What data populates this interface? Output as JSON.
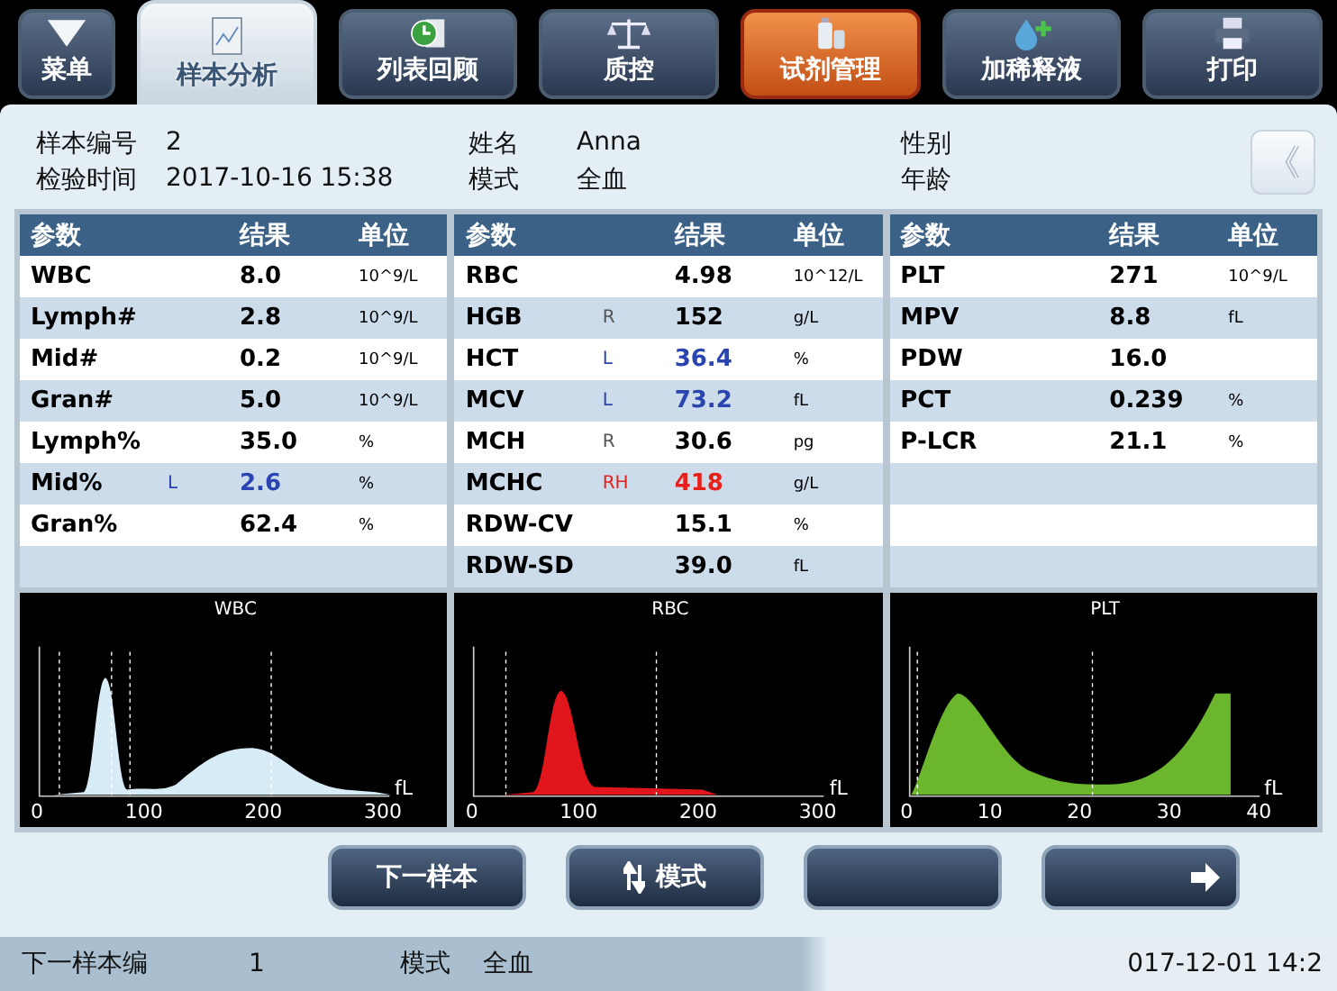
{
  "tabs": [
    {
      "label": "菜单",
      "kind": "menu",
      "selected": false,
      "alert": false
    },
    {
      "label": "样本分析",
      "kind": "chart",
      "selected": true,
      "alert": false
    },
    {
      "label": "列表回顾",
      "kind": "review",
      "selected": false,
      "alert": false
    },
    {
      "label": "质控",
      "kind": "scale",
      "selected": false,
      "alert": false
    },
    {
      "label": "试剂管理",
      "kind": "bottles",
      "selected": false,
      "alert": true
    },
    {
      "label": "加稀释液",
      "kind": "drop",
      "selected": false,
      "alert": false
    },
    {
      "label": "打印",
      "kind": "printer",
      "selected": false,
      "alert": false
    }
  ],
  "info": [
    {
      "label": "样本编号",
      "value": "2"
    },
    {
      "label": "姓名",
      "value": "Anna"
    },
    {
      "label": "性别"
    },
    {
      "label": "检验时间",
      "value": "2017-10-16 15:38"
    },
    {
      "label": "模式",
      "value": "全血"
    },
    {
      "label": "年龄"
    }
  ],
  "collapse_button": {
    "label": "《"
  },
  "tables": [
    {
      "columns": [
        "参数",
        "结果",
        "单位"
      ],
      "rows": [
        {
          "param": "WBC",
          "result": "8.0",
          "unit": "10^9/L",
          "kind": "normal"
        },
        {
          "param": "Lymph#",
          "result": "2.8",
          "unit": "10^9/L",
          "kind": "normal"
        },
        {
          "param": "Mid#",
          "result": "0.2",
          "unit": "10^9/L",
          "kind": "normal"
        },
        {
          "param": "Gran#",
          "result": "5.0",
          "unit": "10^9/L",
          "kind": "normal"
        },
        {
          "param": "Lymph%",
          "result": "35.0",
          "unit": "%",
          "kind": "normal"
        },
        {
          "param": "Mid%",
          "flag": "L",
          "result": "2.6",
          "unit": "%",
          "kind": "low"
        },
        {
          "param": "Gran%",
          "result": "62.4",
          "unit": "%",
          "kind": "normal"
        }
      ]
    },
    {
      "columns": [
        "参数",
        "结果",
        "单位"
      ],
      "rows": [
        {
          "param": "RBC",
          "result": "4.98",
          "unit": "10^12/L",
          "kind": "normal"
        },
        {
          "param": "HGB",
          "flag": "R",
          "result": "152",
          "unit": "g/L",
          "kind": "review"
        },
        {
          "param": "HCT",
          "flag": "L",
          "result": "36.4",
          "unit": "%",
          "kind": "low"
        },
        {
          "param": "MCV",
          "flag": "L",
          "result": "73.2",
          "unit": "fL",
          "kind": "low"
        },
        {
          "param": "MCH",
          "flag": "R",
          "result": "30.6",
          "unit": "pg",
          "kind": "review"
        },
        {
          "param": "MCHC",
          "flag": "RH",
          "result": "418",
          "unit": "g/L",
          "kind": "high"
        },
        {
          "param": "RDW-CV",
          "result": "15.1",
          "unit": "%",
          "kind": "normal"
        },
        {
          "param": "RDW-SD",
          "result": "39.0",
          "unit": "fL",
          "kind": "normal"
        }
      ]
    },
    {
      "columns": [
        "参数",
        "结果",
        "单位"
      ],
      "rows": [
        {
          "param": "PLT",
          "result": "271",
          "unit": "10^9/L",
          "kind": "normal"
        },
        {
          "param": "MPV",
          "result": "8.8",
          "unit": "fL",
          "kind": "normal"
        },
        {
          "param": "PDW",
          "result": "16.0",
          "kind": "normal"
        },
        {
          "param": "PCT",
          "result": "0.239",
          "unit": "%",
          "kind": "normal"
        },
        {
          "param": "P-LCR",
          "result": "21.1",
          "unit": "%",
          "kind": "normal"
        }
      ]
    }
  ],
  "histograms": [
    {
      "title": "WBC",
      "kind": "wbc",
      "color": "#d8ecf8",
      "unit": "fL",
      "ticks": [
        "0",
        "100",
        "200",
        "300"
      ]
    },
    {
      "title": "RBC",
      "kind": "rbc",
      "color": "#e0161c",
      "unit": "fL",
      "ticks": [
        "0",
        "100",
        "200",
        "300"
      ]
    },
    {
      "title": "PLT",
      "kind": "plt",
      "color": "#6cb62e",
      "unit": "fL",
      "ticks": [
        "0",
        "10",
        "20",
        "30",
        "40"
      ]
    }
  ],
  "buttons": [
    {
      "label": "下一样本",
      "kind": "plain"
    },
    {
      "label": "模式",
      "kind": "swap"
    },
    {
      "kind": "plain"
    },
    {
      "kind": "next"
    }
  ],
  "status_bar": {
    "next_label": "下一样本编",
    "next_value": "1",
    "mode_label": "模式",
    "mode_value": "全血",
    "datetime": "017-12-01 14:2"
  }
}
